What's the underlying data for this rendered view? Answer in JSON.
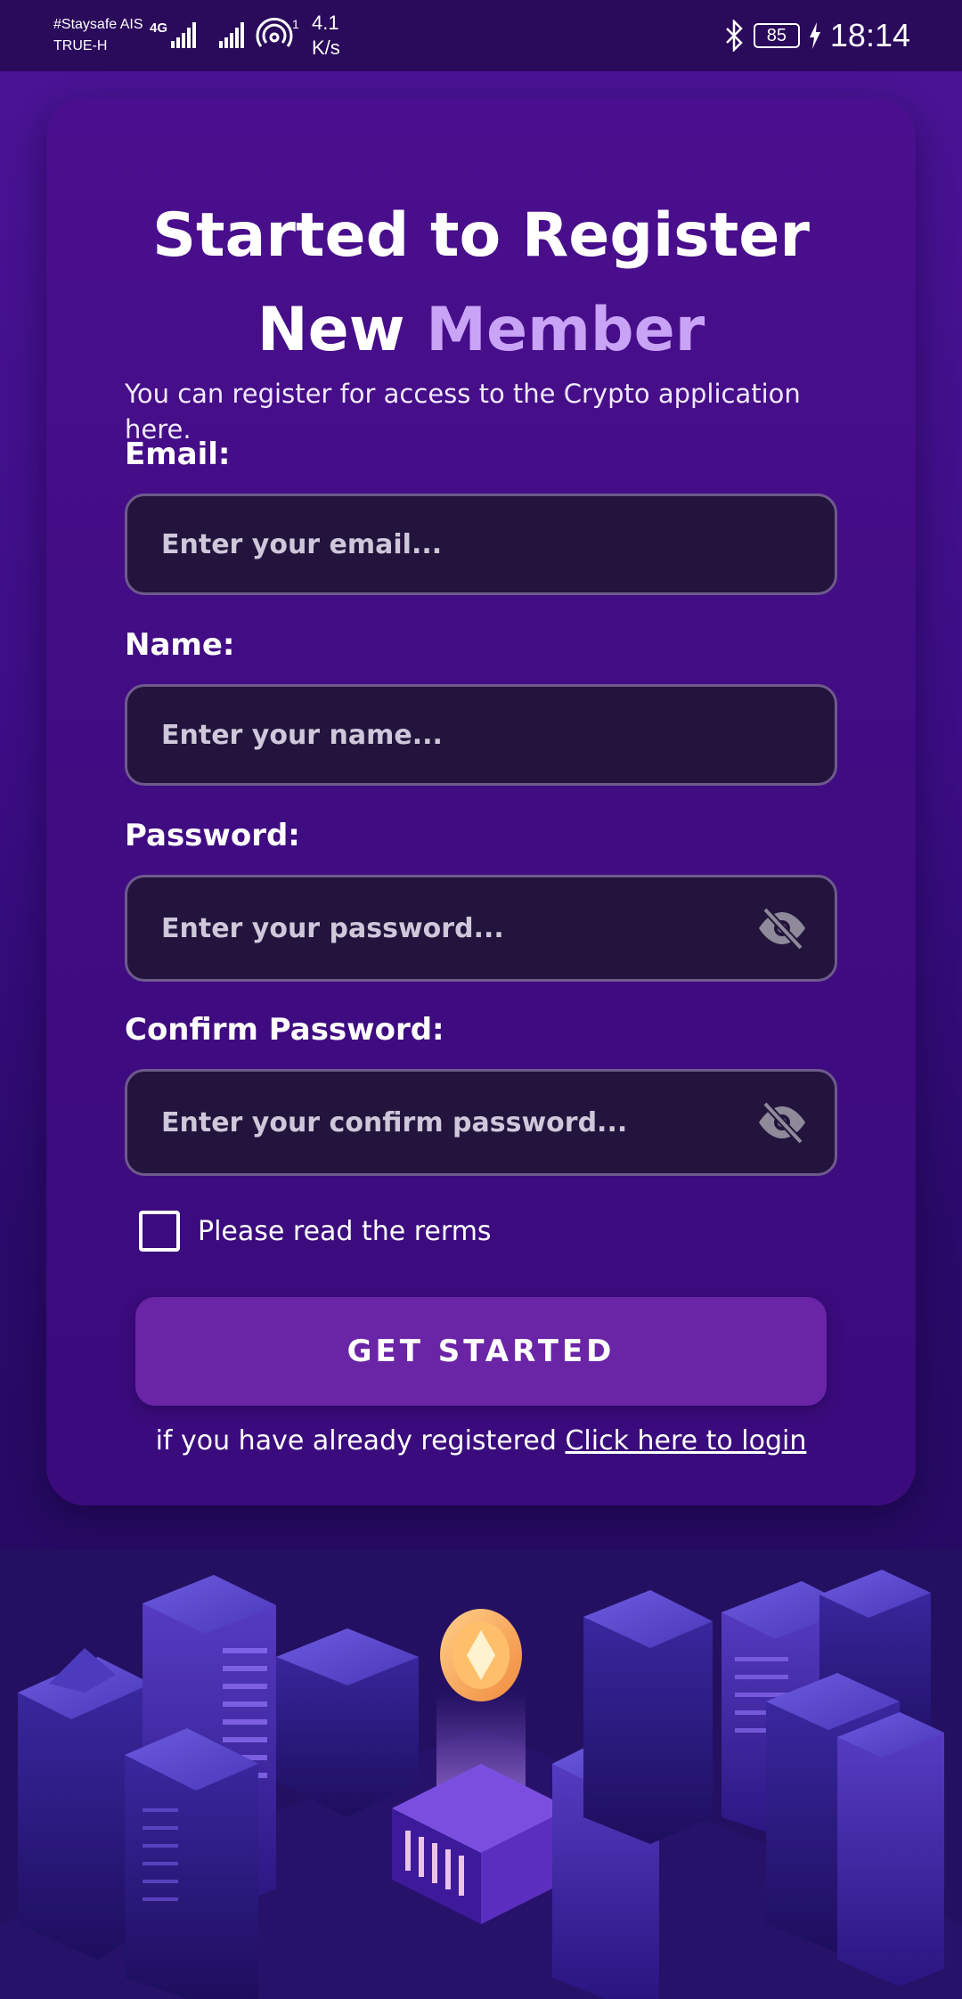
{
  "status_bar": {
    "carrier_line1": "#Staysafe AIS",
    "carrier_line2": "TRUE-H",
    "network_type": "4G",
    "hotspot_count": "1",
    "speed_value": "4.1",
    "speed_unit": "K/s",
    "battery": "85",
    "time": "18:14"
  },
  "header": {
    "title_line1": "Started to Register",
    "title_line2_plain": "New",
    "title_line2_accent": "Member",
    "subtitle": "You can register for access to the Crypto application here."
  },
  "form": {
    "email": {
      "label": "Email:",
      "placeholder": "Enter your email...",
      "value": ""
    },
    "name": {
      "label": "Name:",
      "placeholder": "Enter your name...",
      "value": ""
    },
    "password": {
      "label": "Password:",
      "placeholder": "Enter your password...",
      "value": ""
    },
    "confirm_password": {
      "label": "Confirm Password:",
      "placeholder": "Enter your confirm password...",
      "value": ""
    },
    "terms_label": "Please read the rerms",
    "terms_checked": false,
    "submit_label": "GET STARTED",
    "login_prompt": "if you have already registered",
    "login_link": "Click here to login"
  },
  "icons": {
    "password_toggle": "eye-off-icon",
    "confirm_toggle": "eye-off-icon",
    "bluetooth": "bluetooth-icon",
    "charging": "lightning-icon",
    "signal": "signal-icon",
    "hotspot": "hotspot-icon"
  },
  "colors": {
    "background": "#3b0d84",
    "card": "#430e88",
    "accent_text": "#c9a3f5",
    "input_bg": "#22143c",
    "input_border": "#6e5a8c",
    "button": "#6a24a6"
  }
}
